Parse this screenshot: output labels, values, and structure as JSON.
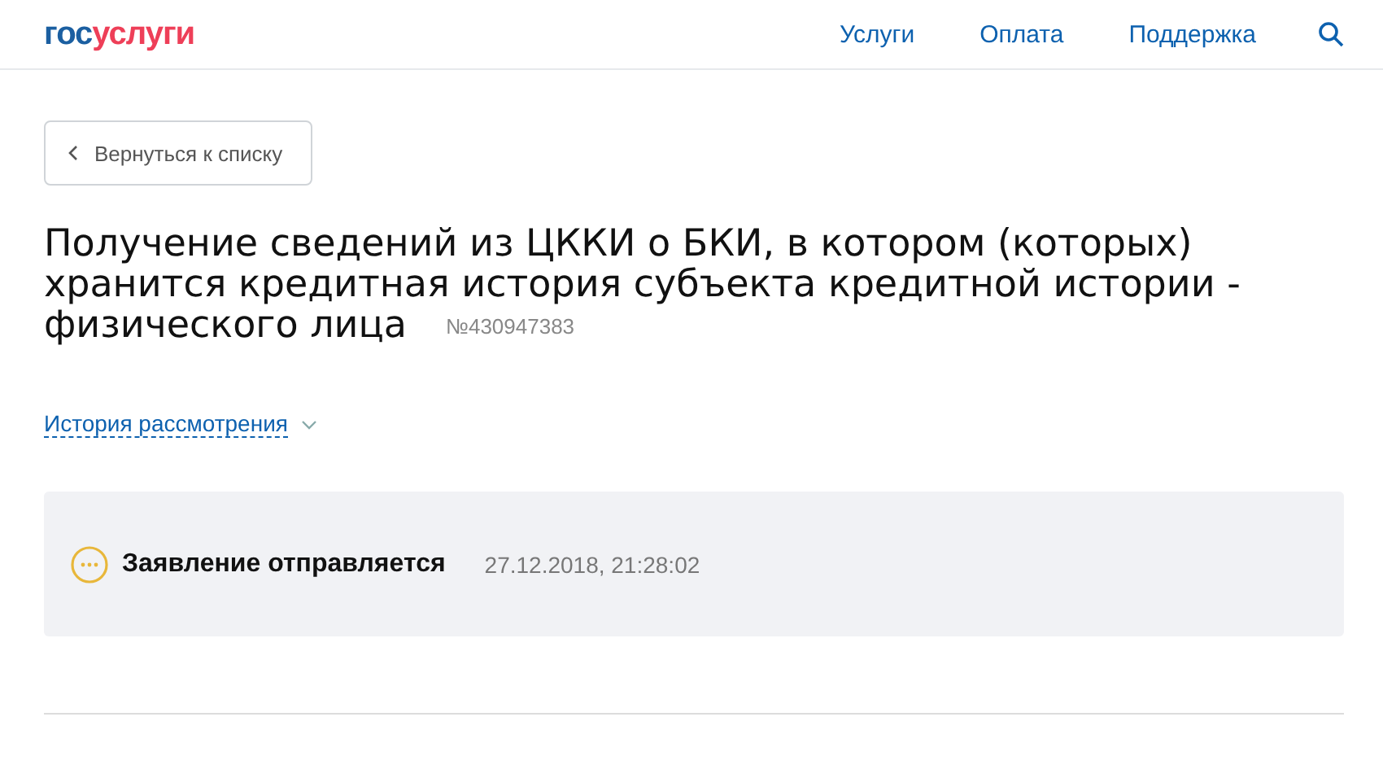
{
  "header": {
    "logo": [
      "гос",
      "услуги"
    ],
    "nav": [
      {
        "label": "Услуги"
      },
      {
        "label": "Оплата"
      },
      {
        "label": "Поддержка"
      }
    ]
  },
  "back_button": {
    "label": "Вернуться к списку"
  },
  "title": "Получение сведений из ЦККИ о БКИ, в котором (которых) хранится кредитная история субъекта кредитной истории - физического лица",
  "number": "№430947383",
  "history_link": {
    "label": "История рассмотрения",
    "expanded": false
  },
  "status": {
    "kind": "pending",
    "label": "Заявление отправляется",
    "time": "27.12.2018, 21:28:02"
  }
}
